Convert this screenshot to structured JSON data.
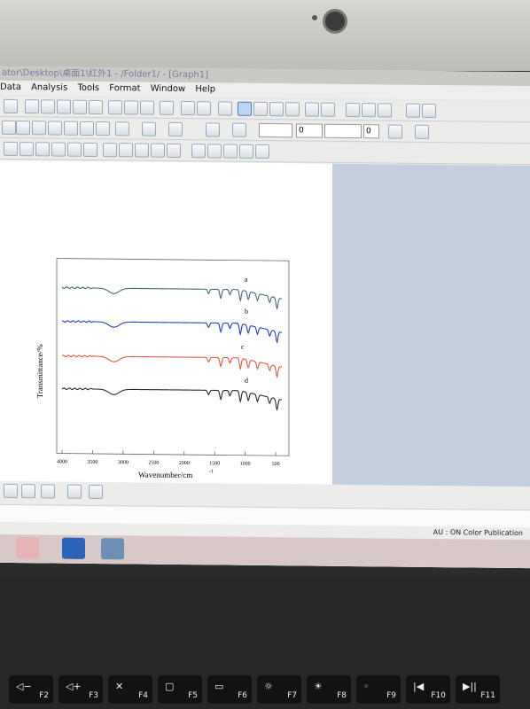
{
  "window": {
    "title": "ator\\Desktop\\桌面1\\红外1 - /Folder1/ - [Graph1]"
  },
  "menu": [
    "Data",
    "Analysis",
    "Tools",
    "Format",
    "Window",
    "Help"
  ],
  "toolbar": {
    "size_value": "0",
    "size_value2": "0"
  },
  "status": {
    "text": "AU : ON   Color Publication"
  },
  "keys": [
    "F2",
    "F3",
    "F4",
    "F5",
    "F6",
    "F7",
    "F8",
    "F9",
    "F10",
    "F11"
  ],
  "chart_data": {
    "type": "line",
    "xlabel": "Wavenumber/cm",
    "xlabel_superscript": "-1",
    "ylabel": "Transmittance/%",
    "x_ticks": [
      "4000",
      "3500",
      "3000",
      "2500",
      "2000",
      "1500",
      "1000",
      "500"
    ],
    "xlim": [
      4000,
      400
    ],
    "x_reversed": true,
    "series": [
      {
        "name": "a",
        "color": "#3f6b74"
      },
      {
        "name": "b",
        "color": "#1f3fc7"
      },
      {
        "name": "c",
        "color": "#e05a3a"
      },
      {
        "name": "d",
        "color": "#2a2a2a"
      }
    ]
  },
  "colors": {
    "window_bg": "#e8e8e6",
    "work_blue": "#c3cfdf",
    "bezel": "#cfcfcb"
  }
}
